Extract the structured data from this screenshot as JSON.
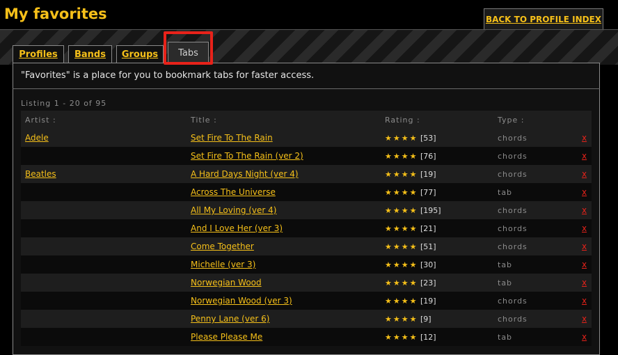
{
  "page": {
    "title": "My favorites",
    "back_label": "BACK TO PROFILE INDEX"
  },
  "tabs": [
    {
      "label": "Profiles"
    },
    {
      "label": "Bands"
    },
    {
      "label": "Groups"
    },
    {
      "label": "Tabs"
    }
  ],
  "intro": "\"Favorites\" is a place for you to bookmark tabs for faster access.",
  "listing": "Listing 1 - 20 of 95",
  "columns": {
    "artist": "Artist :",
    "title": "Title :",
    "rating": "Rating :",
    "type": "Type :"
  },
  "rating_stars": "★★★★",
  "delete_label": "x",
  "colors": {
    "accent": "#f6c019",
    "highlight": "#e8221a",
    "delete": "#e8221a"
  },
  "rows": [
    {
      "artist": "Adele",
      "title": "Set Fire To The Rain",
      "count": "[53]",
      "type": "chords"
    },
    {
      "artist": "",
      "title": "Set Fire To The Rain (ver 2)",
      "count": "[76]",
      "type": "chords"
    },
    {
      "artist": "Beatles",
      "title": "A Hard Days Night (ver 4)",
      "count": "[19]",
      "type": "chords"
    },
    {
      "artist": "",
      "title": "Across The Universe",
      "count": "[77]",
      "type": "tab"
    },
    {
      "artist": "",
      "title": "All My Loving (ver 4)",
      "count": "[195]",
      "type": "chords"
    },
    {
      "artist": "",
      "title": "And I Love Her (ver 3)",
      "count": "[21]",
      "type": "chords"
    },
    {
      "artist": "",
      "title": "Come Together",
      "count": "[51]",
      "type": "chords"
    },
    {
      "artist": "",
      "title": "Michelle (ver 3)",
      "count": "[30]",
      "type": "tab"
    },
    {
      "artist": "",
      "title": "Norwegian Wood",
      "count": "[23]",
      "type": "tab"
    },
    {
      "artist": "",
      "title": "Norwegian Wood (ver 3)",
      "count": "[19]",
      "type": "chords"
    },
    {
      "artist": "",
      "title": "Penny Lane (ver 6)",
      "count": "[9]",
      "type": "chords"
    },
    {
      "artist": "",
      "title": "Please Please Me",
      "count": "[12]",
      "type": "tab"
    }
  ]
}
